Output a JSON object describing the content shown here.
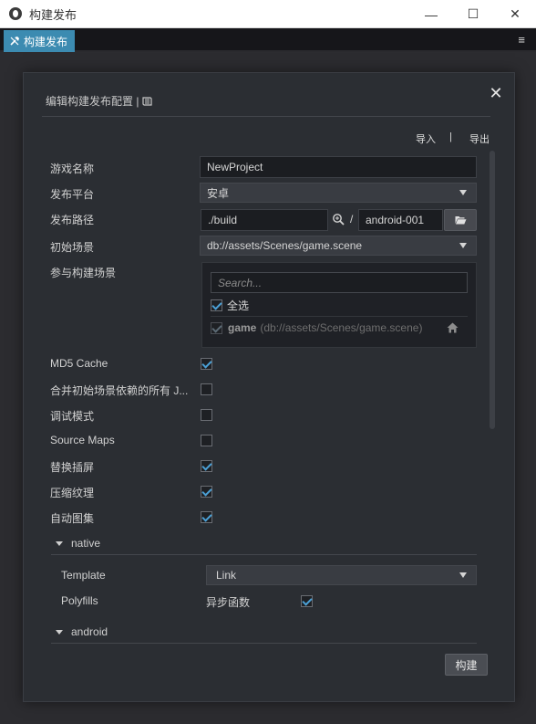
{
  "window": {
    "title": "构建发布",
    "controls": {
      "minimize": "—",
      "maximize": "☐",
      "close": "✕"
    }
  },
  "panel_tab": {
    "label": "构建发布",
    "menu_icon": "≡"
  },
  "dialog": {
    "header": "编辑构建发布配置 |",
    "close_icon": "✕",
    "import_label": "导入",
    "separator": "|",
    "export_label": "导出",
    "fields": {
      "game_name": {
        "label": "游戏名称",
        "value": "NewProject"
      },
      "platform": {
        "label": "发布平台",
        "value": "安卓"
      },
      "build_path": {
        "label": "发布路径",
        "value": "./build",
        "slash": "/",
        "folder_name": "android-001"
      },
      "start_scene": {
        "label": "初始场景",
        "value": "db://assets/Scenes/game.scene"
      },
      "included_scenes": {
        "label": "参与构建场景",
        "search_placeholder": "Search...",
        "select_all_label": "全选",
        "select_all_checked": true,
        "scenes": [
          {
            "name": "game",
            "path": "(db://assets/Scenes/game.scene)",
            "checked": true
          }
        ]
      }
    },
    "options": [
      {
        "label": "MD5 Cache",
        "checked": true
      },
      {
        "label": "合并初始场景依赖的所有 J...",
        "checked": false
      },
      {
        "label": "调试模式",
        "checked": false
      },
      {
        "label": "Source Maps",
        "checked": false
      },
      {
        "label": "替换插屏",
        "checked": true
      },
      {
        "label": "压缩纹理",
        "checked": true
      },
      {
        "label": "自动图集",
        "checked": true
      }
    ],
    "native": {
      "title": "native",
      "template_label": "Template",
      "template_value": "Link",
      "polyfills_label": "Polyfills",
      "async_label": "异步函数",
      "async_checked": true
    },
    "android": {
      "title": "android"
    },
    "build_button": "构建"
  },
  "colors": {
    "tab_accent": "#3c8bb1",
    "checkmark": "#4ba0d6",
    "dialog_bg": "#2b2e33",
    "input_bg": "#1b1d21"
  }
}
